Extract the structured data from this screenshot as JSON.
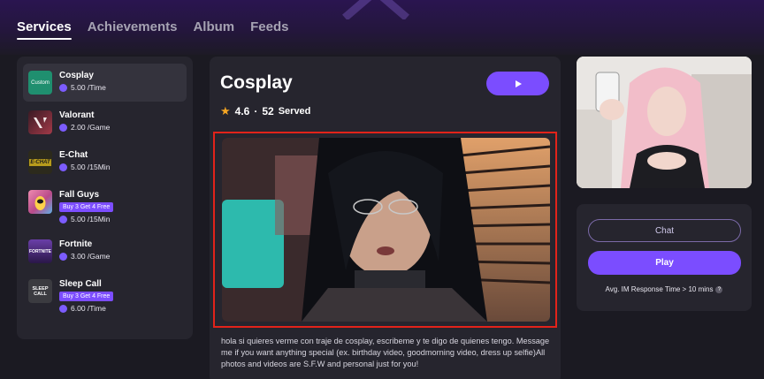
{
  "nav": {
    "tabs": [
      {
        "label": "Services",
        "active": true
      },
      {
        "label": "Achievements",
        "active": false
      },
      {
        "label": "Album",
        "active": false
      },
      {
        "label": "Feeds",
        "active": false
      }
    ]
  },
  "sidebar": {
    "items": [
      {
        "name": "Cosplay",
        "price": "5.00 /Time",
        "icon": "custom-icon",
        "icon_text": "Custom",
        "icon_color": "#1f8f6f",
        "active": true
      },
      {
        "name": "Valorant",
        "price": "2.00 /Game",
        "icon": "valorant-game-icon",
        "icon_text": "",
        "icon_color": "#7a2b36"
      },
      {
        "name": "E-Chat",
        "price": "5.00 /15Min",
        "icon": "e-chat-icon",
        "icon_text": "E-CHAT",
        "icon_color": "#b79b1c"
      },
      {
        "name": "Fall Guys",
        "promo": "Buy 3 Get 4 Free",
        "price": "5.00 /15Min",
        "icon": "fall-guys-game-icon",
        "icon_text": "",
        "icon_color": "#d8567a"
      },
      {
        "name": "Fortnite",
        "price": "3.00 /Game",
        "icon": "fortnite-game-icon",
        "icon_text": "FORTNITE",
        "icon_color": "#4b2a78"
      },
      {
        "name": "Sleep Call",
        "promo": "Buy 3 Get 4 Free",
        "price": "6.00 /Time",
        "icon": "sleep-call-icon",
        "icon_text": "SLEEP CALL",
        "icon_color": "#3b3b40"
      }
    ]
  },
  "main": {
    "title": "Cosplay",
    "rating": "4.6",
    "separator": "·",
    "served_count": "52",
    "served_label": "Served",
    "description": "hola si quieres verme con traje de cosplay, escribeme y te digo de quienes tengo. Message me if you want anything special (ex. birthday video, goodmorning video, dress up selfie)All photos and videos are S.F.W and personal just for you!"
  },
  "actions": {
    "chat_label": "Chat",
    "play_label": "Play",
    "response_time": "Avg. IM Response Time > 10 mins",
    "help_glyph": "?"
  },
  "colors": {
    "accent": "#7b4dff",
    "highlight_border": "#e2231a",
    "star": "#f5a623"
  }
}
